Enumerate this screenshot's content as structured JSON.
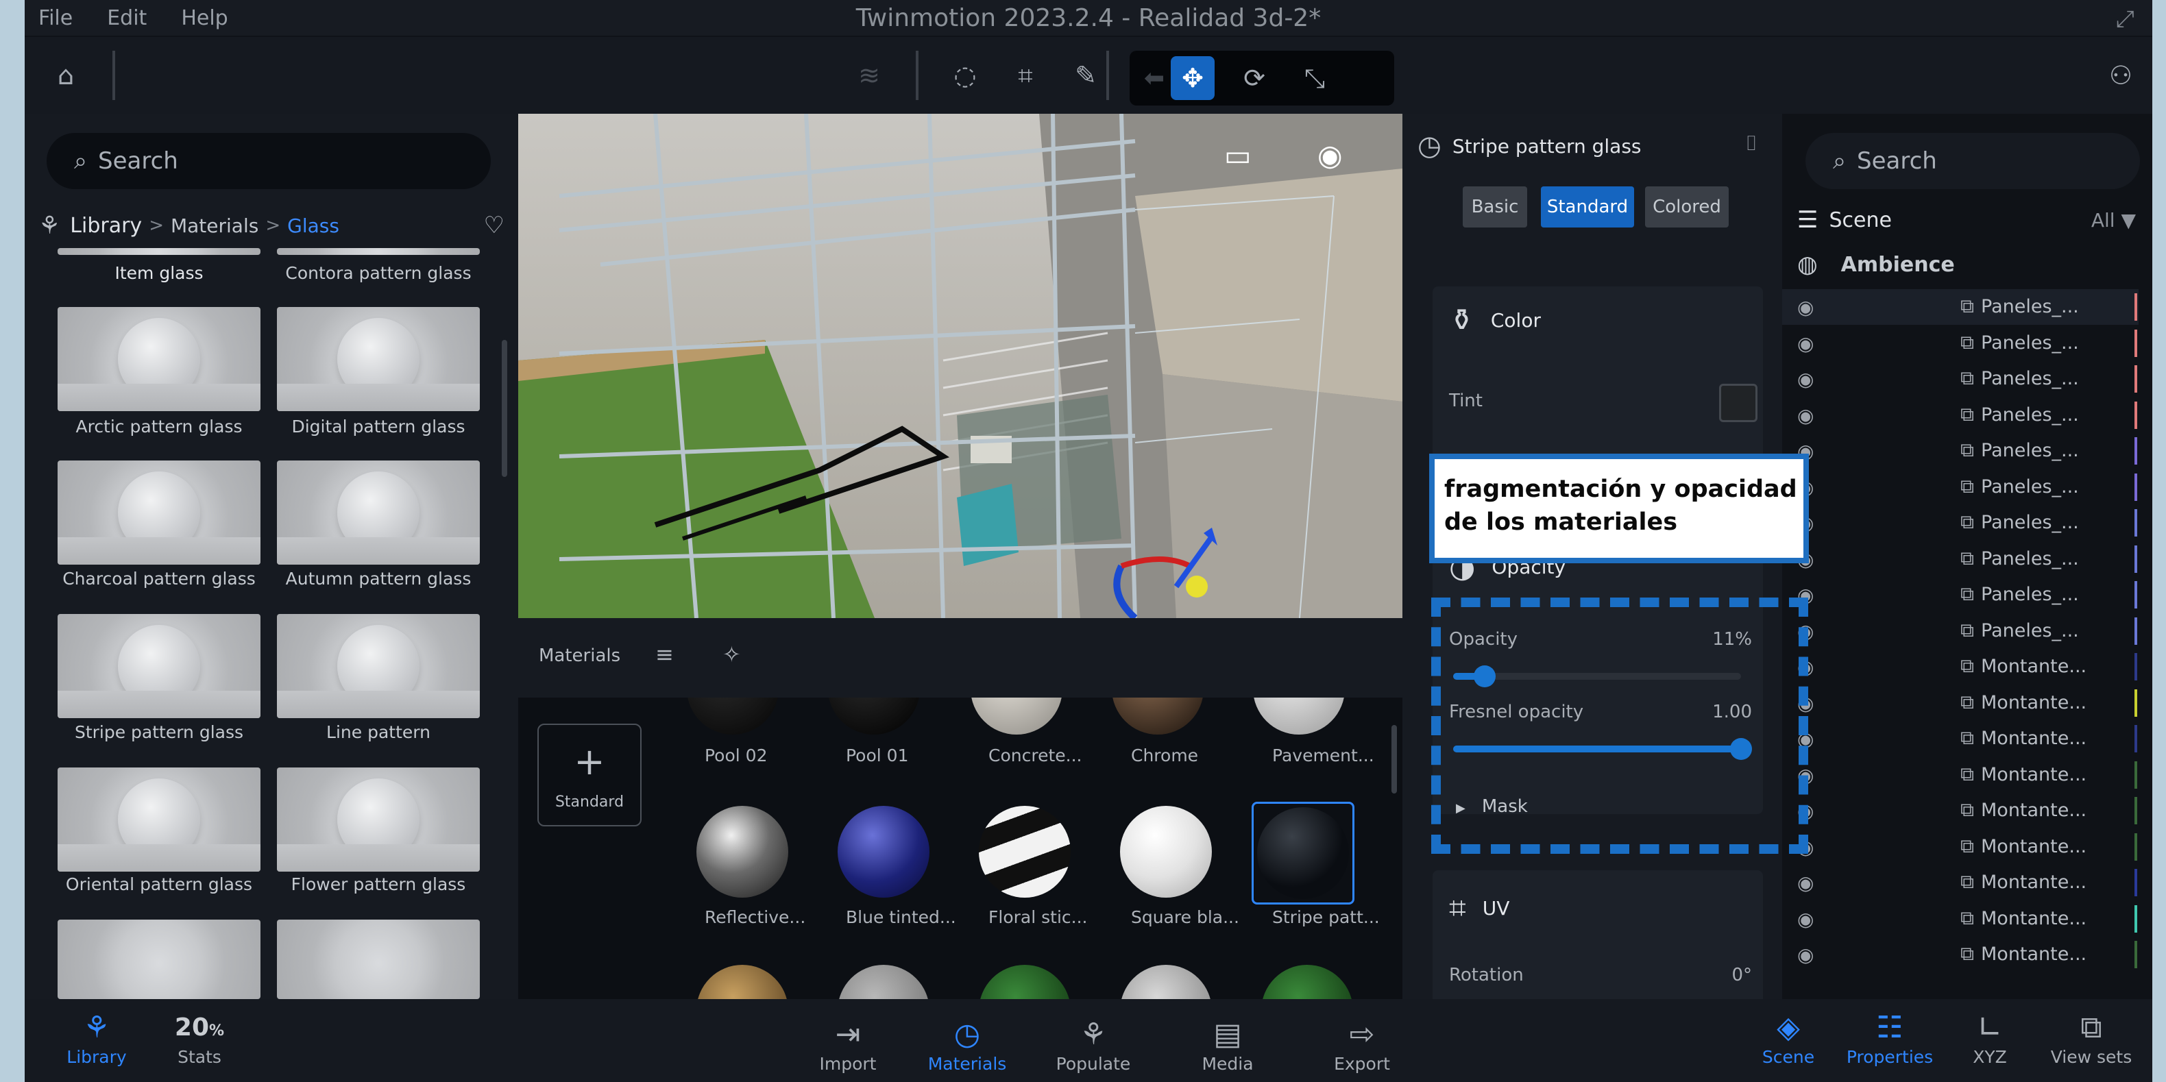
{
  "app": {
    "title": "Twinmotion 2023.2.4 - Realidad 3d-2*",
    "menu": [
      "File",
      "Edit",
      "Help"
    ],
    "accent_color": "#1565c0"
  },
  "toolbar": {
    "icons": [
      "home-icon",
      "layers-icon",
      "orbit-icon",
      "grid-icon",
      "eyedropper-icon",
      "back-arrow-icon",
      "move-icon",
      "rotate-icon",
      "scale-icon",
      "person-icon"
    ]
  },
  "library": {
    "search_placeholder": "Search",
    "breadcrumb": {
      "root": "Library",
      "level1": "Materials",
      "level2": "Glass"
    },
    "top_labels": [
      "Item glass",
      "Contora pattern glass"
    ],
    "items": [
      "Arctic pattern glass",
      "Digital pattern glass",
      "Charcoal pattern glass",
      "Autumn pattern glass",
      "Stripe pattern glass",
      "Line pattern",
      "Oriental pattern glass",
      "Flower pattern glass"
    ]
  },
  "materials": {
    "title": "Materials",
    "standard_label": "Standard",
    "row1": [
      "Pool 02",
      "Pool 01",
      "Concrete...",
      "Chrome",
      "Pavement..."
    ],
    "row2": [
      "Reflective...",
      "Blue tinted...",
      "Floral stic...",
      "Square bla...",
      "Stripe patt..."
    ]
  },
  "properties": {
    "material_name": "Stripe pattern glass",
    "modes": [
      "Basic",
      "Standard",
      "Colored"
    ],
    "active_mode": "Standard",
    "color_section": "Color",
    "tint_label": "Tint",
    "opacity_section": "Opacity",
    "opacity_label": "Opacity",
    "opacity_value": "11%",
    "opacity_level": 0.11,
    "fresnel_label": "Fresnel opacity",
    "fresnel_value": "1.00",
    "fresnel_level": 1.0,
    "mask_label": "Mask",
    "uv_section": "UV",
    "rotation_label": "Rotation",
    "rotation_value": "0°"
  },
  "annotation": {
    "text": "fragmentación y opacidad de los materiales"
  },
  "scene": {
    "search_placeholder": "Search",
    "title": "Scene",
    "filter": "All",
    "ambience": "Ambience",
    "items": [
      {
        "name": "Paneles_...",
        "color": "#e07a7a"
      },
      {
        "name": "Paneles_...",
        "color": "#e07a7a"
      },
      {
        "name": "Paneles_...",
        "color": "#e07a7a"
      },
      {
        "name": "Paneles_...",
        "color": "#e07a7a"
      },
      {
        "name": "Paneles_...",
        "color": "#7a6ad6"
      },
      {
        "name": "Paneles_...",
        "color": "#7a6ad6"
      },
      {
        "name": "Paneles_...",
        "color": "#6a78d6"
      },
      {
        "name": "Paneles_...",
        "color": "#6a78d6"
      },
      {
        "name": "Paneles_...",
        "color": "#6a78d6"
      },
      {
        "name": "Paneles_...",
        "color": "#6a78d6"
      },
      {
        "name": "Montante...",
        "color": "#2d3a8a"
      },
      {
        "name": "Montante...",
        "color": "#c8d030"
      },
      {
        "name": "Montante...",
        "color": "#2d3a8a"
      },
      {
        "name": "Montante...",
        "color": "#3a6a3a"
      },
      {
        "name": "Montante...",
        "color": "#3a6a3a"
      },
      {
        "name": "Montante...",
        "color": "#3a6a3a"
      },
      {
        "name": "Montante...",
        "color": "#2a3a9a"
      },
      {
        "name": "Montante...",
        "color": "#40c8b0"
      },
      {
        "name": "Montante...",
        "color": "#3a6a3a"
      }
    ]
  },
  "bottom_bar": {
    "library": "Library",
    "stats_value": "20",
    "stats_unit": "%",
    "stats": "Stats",
    "import": "Import",
    "materials": "Materials",
    "populate": "Populate",
    "media": "Media",
    "export": "Export",
    "scene": "Scene",
    "properties": "Properties",
    "xyz": "XYZ",
    "view_sets": "View sets"
  }
}
